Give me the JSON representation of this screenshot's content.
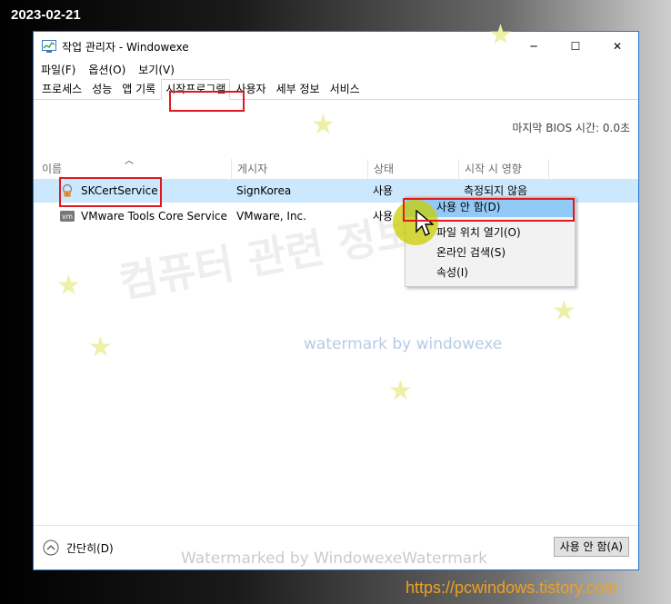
{
  "date_stamp": "2023-02-21",
  "window": {
    "title": "작업 관리자  - Windowexe",
    "controls": {
      "minimize": "─",
      "maximize": "☐",
      "close": "✕"
    }
  },
  "menubar": [
    "파일(F)",
    "옵션(O)",
    "보기(V)"
  ],
  "tabs": [
    "프로세스",
    "성능",
    "앱 기록",
    "시작프로그램",
    "사용자",
    "세부 정보",
    "서비스"
  ],
  "active_tab": "시작프로그램",
  "bios_time": "마지막 BIOS 시간:  0.0초",
  "columns": [
    "이름",
    "게시자",
    "상태",
    "시작 시 영향"
  ],
  "rows": [
    {
      "name": "SKCertService",
      "publisher": "SignKorea",
      "status": "사용",
      "impact": "측정되지 않음",
      "icon": "certificate-icon"
    },
    {
      "name": "VMware Tools Core Service",
      "publisher": "VMware, Inc.",
      "status": "사용",
      "impact": "",
      "icon": "vmware-icon"
    }
  ],
  "context_menu": [
    "사용 안 함(D)",
    "파일 위치 열기(O)",
    "온라인 검색(S)",
    "속성(I)"
  ],
  "footer": {
    "collapse_label": "간단히(D)",
    "disable_button": "사용 안 함(A)"
  },
  "watermarks": {
    "korean": "컴퓨터 관련 정보",
    "blue": "watermark by windowexe",
    "bottom": "Watermarked by WindowexeWatermark"
  },
  "site_url": "https://pcwindows.tistory.com",
  "colors": {
    "window_border": "#1e74d1",
    "selection": "#cce8ff",
    "menu_highlight": "#91c9f7",
    "callout": "#e0191f",
    "url": "#f0a020"
  }
}
